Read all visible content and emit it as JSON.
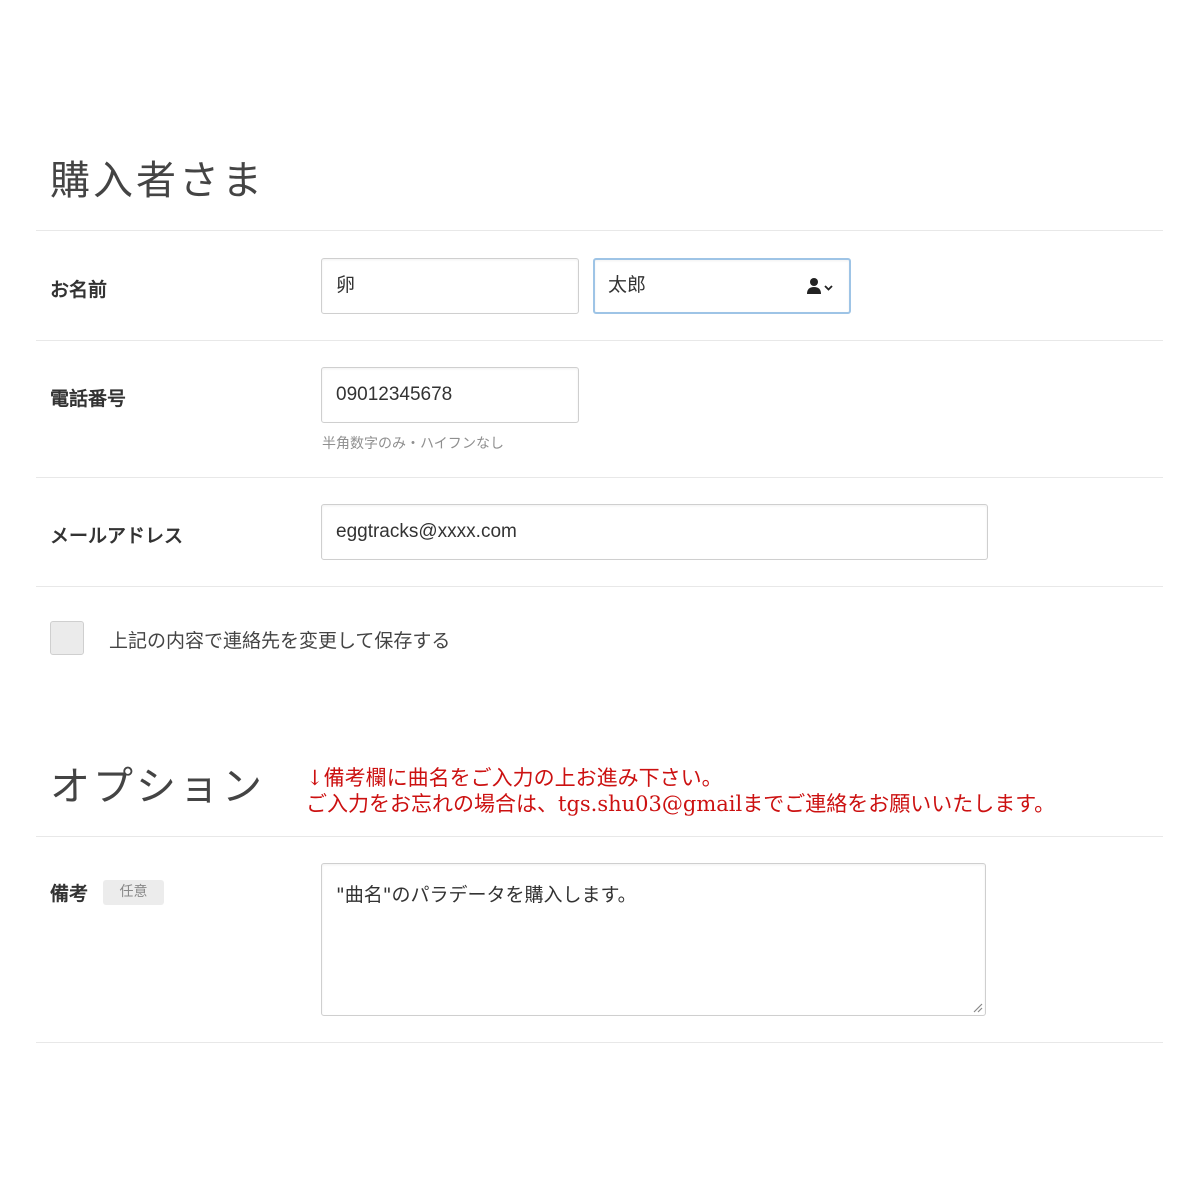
{
  "buyer_section": {
    "title": "購入者さま"
  },
  "name_row": {
    "label": "お名前",
    "last_name_value": "卵",
    "first_name_value": "太郎",
    "contact_icon": "person-dropdown-icon"
  },
  "phone_row": {
    "label": "電話番号",
    "value": "09012345678",
    "hint": "半角数字のみ・ハイフンなし"
  },
  "email_row": {
    "label": "メールアドレス",
    "value": "eggtracks@xxxx.com"
  },
  "save_contact": {
    "checked": false,
    "label": "上記の内容で連絡先を変更して保存する"
  },
  "options_section": {
    "title": "オプション",
    "annotation_line1": "↓備考欄に曲名をご入力の上お進み下さい。",
    "annotation_line2": "ご入力をお忘れの場合は、tgs.shu03@gmailまでご連絡をお願いいたします。",
    "annotation_color": "#cc1111"
  },
  "notes_row": {
    "label": "備考",
    "badge": "任意",
    "value": "\"曲名\"のパラデータを購入します。"
  },
  "colors": {
    "input_border": "#cfcfcf",
    "focus_border": "#9ec4e6",
    "divider": "#e8e8e8"
  }
}
